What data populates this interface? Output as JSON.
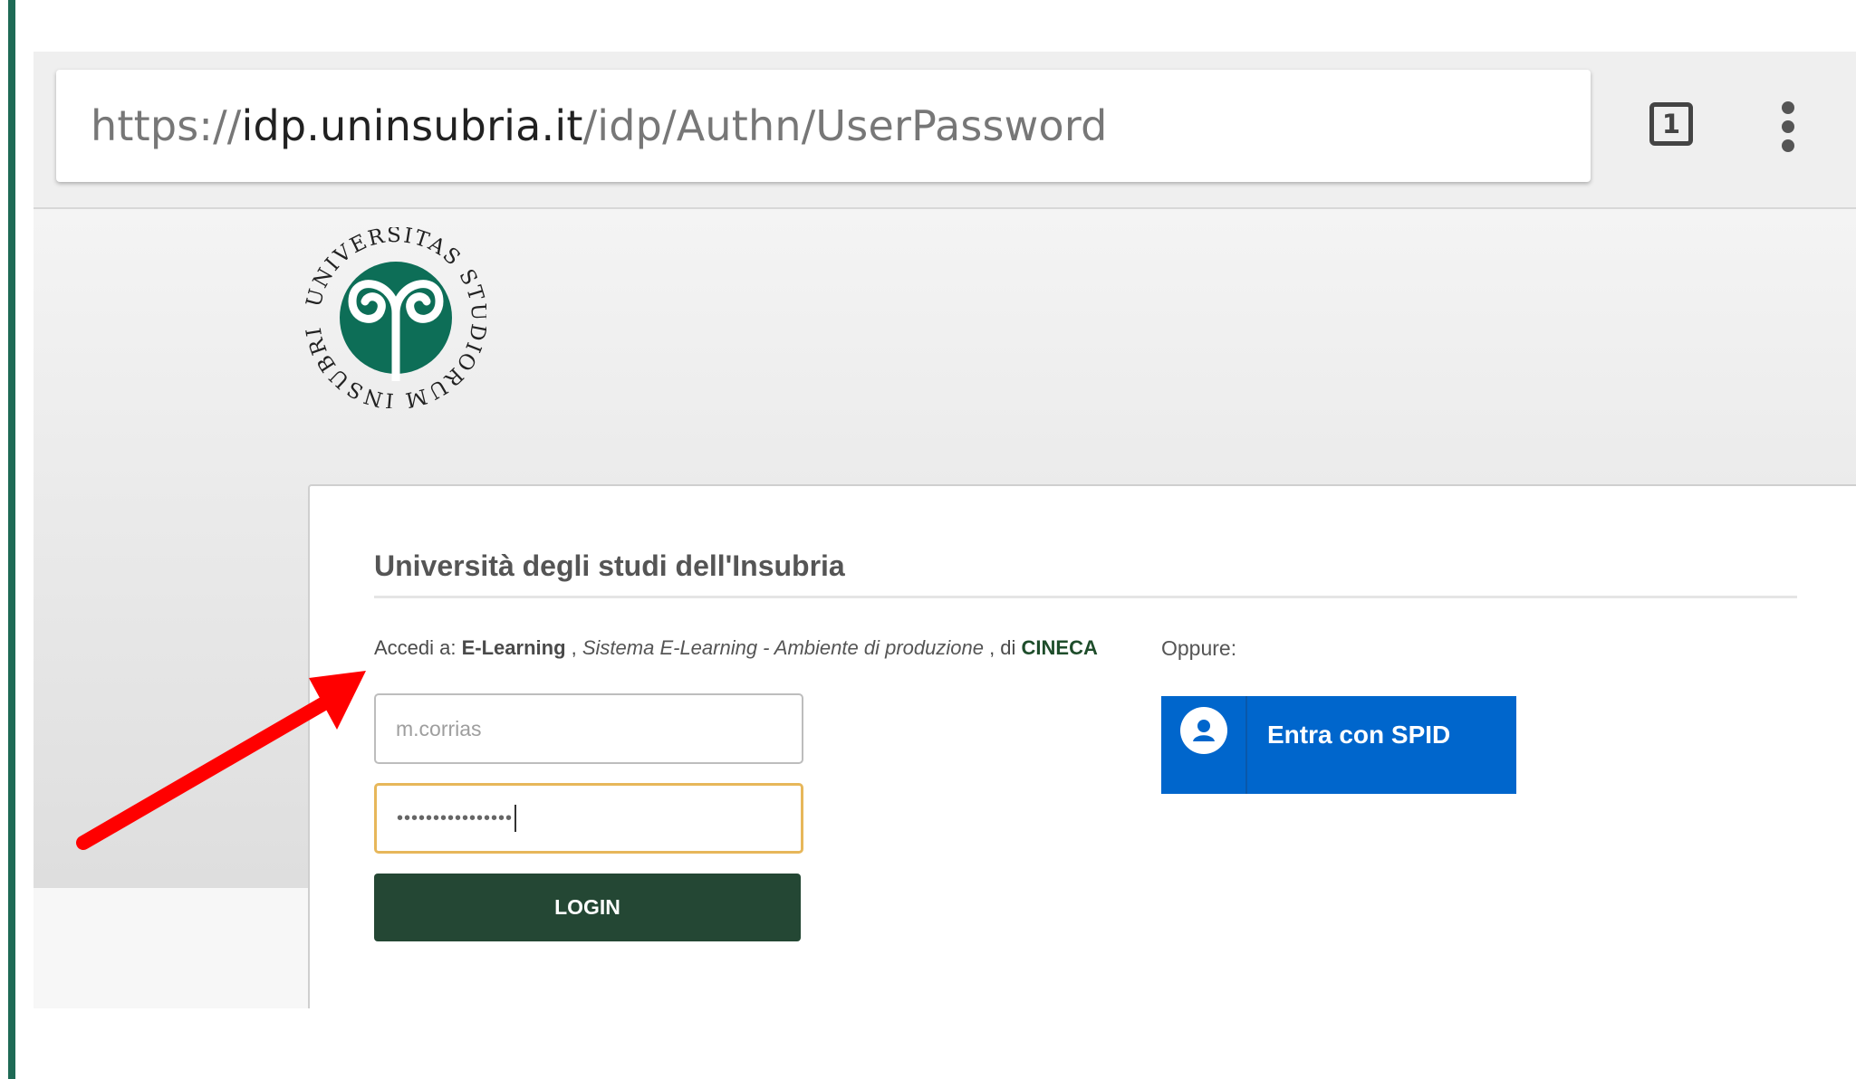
{
  "browser": {
    "url_scheme": "https://",
    "url_host": "idp.uninsubria.it",
    "url_path": "/idp/Authn/UserPassword",
    "tab_count": "1",
    "tabs_icon": "tab-switcher-icon",
    "menu_icon": "overflow-menu-icon"
  },
  "logo": {
    "icon": "university-seal",
    "text": "UNIVERSITAS STUDIORUM INSUBRIAE",
    "color": "#0d6e57"
  },
  "login": {
    "title": "Università degli studi dell'Insubria",
    "access_prefix": "Accedi a: ",
    "service_name": "E-Learning",
    "service_separator": " , ",
    "service_description": "Sistema E-Learning - Ambiente di produzione",
    "provider_separator": " , di ",
    "provider": "CINECA",
    "username_value": "m.corrias",
    "password_mask": "••••••••••••••••",
    "login_label": "LOGIN",
    "login_color": "#244734"
  },
  "spid": {
    "or_label": "Oppure:",
    "button_label": "Entra con SPID",
    "icon": "user-circle-icon",
    "color": "#0066cc"
  },
  "annotation": {
    "icon": "red-arrow-pointer",
    "color": "#ff0000"
  }
}
